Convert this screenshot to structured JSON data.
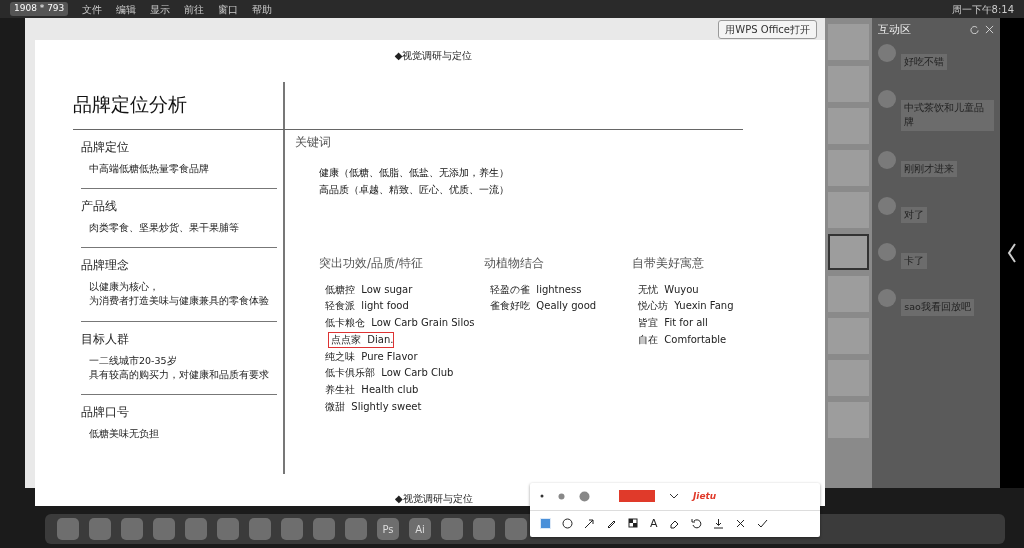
{
  "menubar": {
    "resolution": "1908 * 793",
    "menus": [
      "文件",
      "编辑",
      "显示",
      "前往",
      "窗口",
      "帮助"
    ],
    "clock": "周一下午8:14"
  },
  "window": {
    "open_with": "用WPS Office打开"
  },
  "document": {
    "header": "◆视觉调研与定位",
    "footer": "◆视觉调研与定位",
    "title": "品牌定位分析",
    "sections": [
      {
        "heading": "品牌定位",
        "lines": [
          "中高端低糖低热量零食品牌"
        ]
      },
      {
        "heading": "产品线",
        "lines": [
          "肉类零食、坚果炒货、果干果脯等"
        ]
      },
      {
        "heading": "品牌理念",
        "lines": [
          "以健康为核心，",
          "为消费者打造美味与健康兼具的零食体验"
        ]
      },
      {
        "heading": "目标人群",
        "lines": [
          "一二线城市20-35岁",
          "具有较高的购买力，对健康和品质有要求"
        ]
      },
      {
        "heading": "品牌口号",
        "lines": [
          "低糖美味无负担"
        ]
      }
    ],
    "keywords": {
      "heading": "关键词",
      "lines": [
        "健康（低糖、低脂、低盐、无添加，养生）",
        "高品质（卓越、精致、匠心、优质、一流）"
      ],
      "columns": [
        {
          "heading": "突出功效/品质/特征",
          "items": [
            {
              "cn": "低糖控",
              "en": "Low sugar",
              "selected": false
            },
            {
              "cn": "轻食派",
              "en": "light food",
              "selected": false
            },
            {
              "cn": "低卡粮仓",
              "en": "Low Carb Grain Silos",
              "selected": false
            },
            {
              "cn": "点点家",
              "en": "Dian.",
              "selected": true
            },
            {
              "cn": "纯之味",
              "en": "Pure Flavor",
              "selected": false
            },
            {
              "cn": "低卡俱乐部",
              "en": "Low Carb Club",
              "selected": false
            },
            {
              "cn": "养生社",
              "en": "Health club",
              "selected": false
            },
            {
              "cn": "微甜",
              "en": "Slightly sweet",
              "selected": false
            }
          ]
        },
        {
          "heading": "动植物结合",
          "items": [
            {
              "cn": "轻盈の雀",
              "en": "lightness",
              "selected": false
            },
            {
              "cn": "雀食好吃",
              "en": "Qeally good",
              "selected": false
            }
          ]
        },
        {
          "heading": "自带美好寓意",
          "items": [
            {
              "cn": "无忧",
              "en": "Wuyou",
              "selected": false
            },
            {
              "cn": "悦心坊",
              "en": "Yuexin Fang",
              "selected": false
            },
            {
              "cn": "皆宜",
              "en": "Fit for all",
              "selected": false
            },
            {
              "cn": "自在",
              "en": "Comfortable",
              "selected": false
            }
          ]
        }
      ]
    }
  },
  "thumbnails": [
    {
      "selected": false
    },
    {
      "selected": false
    },
    {
      "selected": false
    },
    {
      "selected": false
    },
    {
      "selected": false
    },
    {
      "selected": true
    },
    {
      "selected": false
    },
    {
      "selected": false
    },
    {
      "selected": false
    },
    {
      "selected": false
    }
  ],
  "chat": {
    "title": "互动区",
    "messages": [
      {
        "text": "好吃不错"
      },
      {
        "text": "中式茶饮和儿童品牌"
      },
      {
        "text": "刚刚才进来"
      },
      {
        "text": "对了"
      },
      {
        "text": "卡了"
      },
      {
        "text": "sao我看回放吧"
      }
    ]
  },
  "annotation_toolbar": {
    "color": "#e03a2a",
    "brand": "Jietu",
    "tools": [
      {
        "kind": "rect",
        "selected": true
      },
      {
        "kind": "circle",
        "selected": false
      },
      {
        "kind": "arrow",
        "selected": false
      },
      {
        "kind": "pen",
        "selected": false
      },
      {
        "kind": "mosaic",
        "selected": false
      },
      {
        "kind": "text",
        "label": "A",
        "selected": false
      },
      {
        "kind": "eraser",
        "selected": false
      },
      {
        "kind": "undo"
      },
      {
        "kind": "download"
      },
      {
        "kind": "close"
      },
      {
        "kind": "check"
      }
    ]
  },
  "dock": {
    "apps": [
      {
        "kind": "icon"
      },
      {
        "kind": "icon"
      },
      {
        "kind": "icon"
      },
      {
        "kind": "icon"
      },
      {
        "kind": "icon"
      },
      {
        "kind": "icon"
      },
      {
        "kind": "icon"
      },
      {
        "kind": "icon"
      },
      {
        "kind": "icon"
      },
      {
        "kind": "icon"
      },
      {
        "kind": "text",
        "label": "Ps"
      },
      {
        "kind": "text",
        "label": "Ai"
      },
      {
        "kind": "icon"
      },
      {
        "kind": "icon"
      },
      {
        "kind": "icon"
      }
    ]
  }
}
